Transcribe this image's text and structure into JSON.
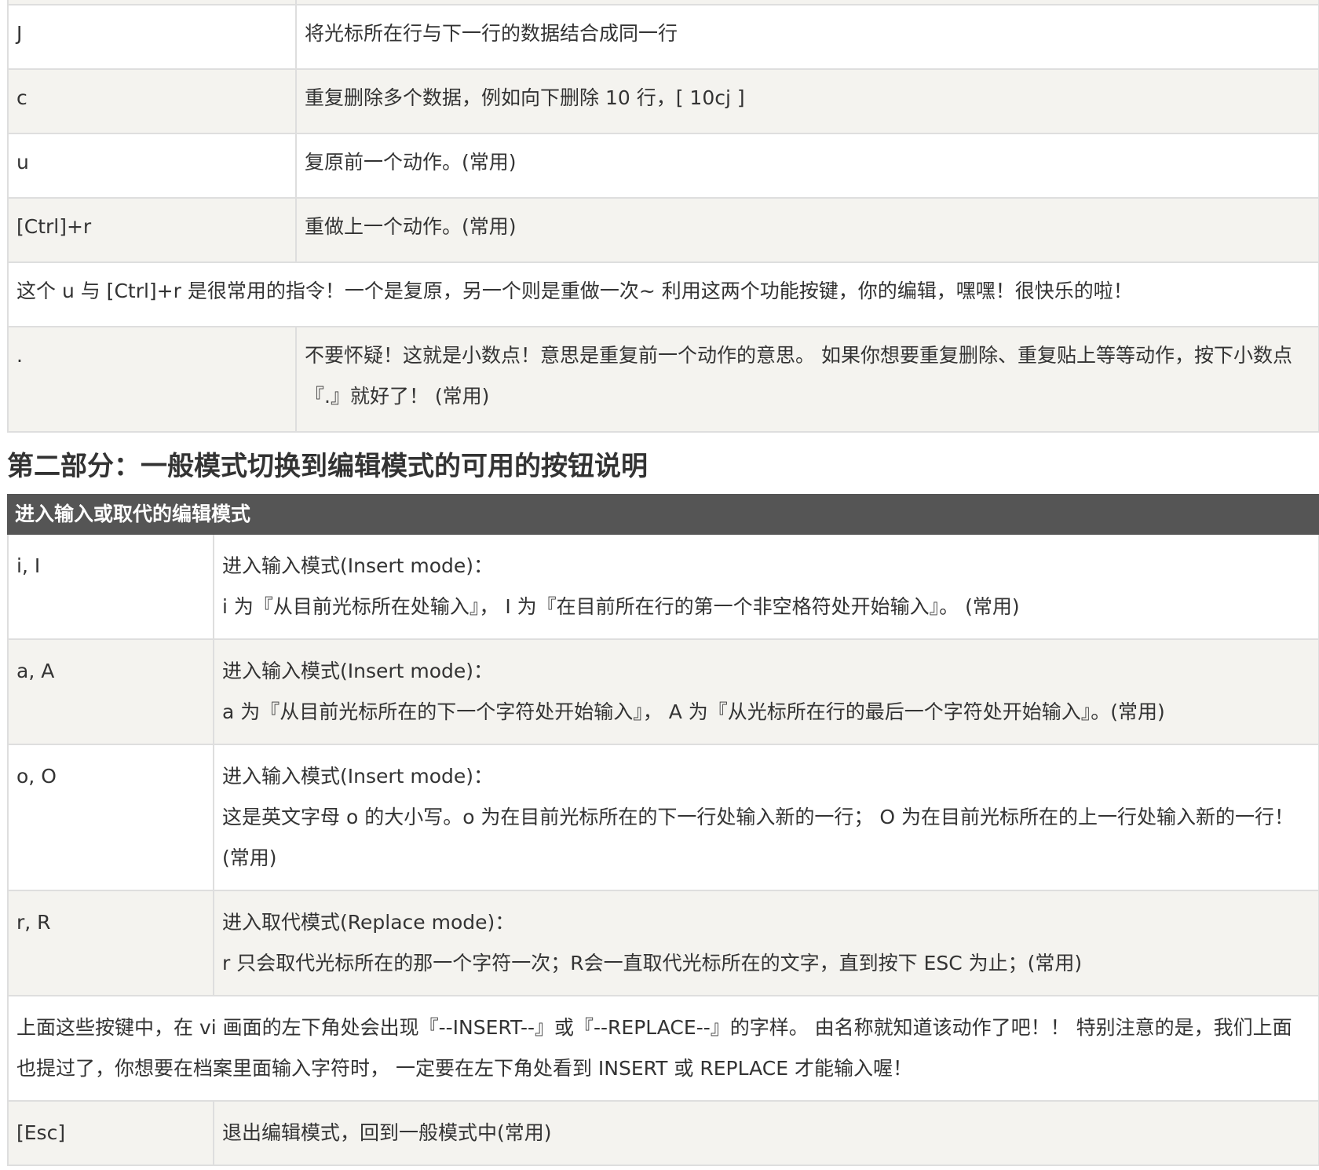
{
  "table1": {
    "rows": [
      {
        "key": "J",
        "desc": "将光标所在行与下一行的数据结合成同一行"
      },
      {
        "key": "c",
        "desc": "重复删除多个数据，例如向下删除 10 行，[ 10cj ]"
      },
      {
        "key": "u",
        "desc": "复原前一个动作。(常用)"
      },
      {
        "key": "[Ctrl]+r",
        "desc": "重做上一个动作。(常用)"
      }
    ],
    "note": "这个 u 与 [Ctrl]+r 是很常用的指令！一个是复原，另一个则是重做一次~ 利用这两个功能按键，你的编辑，嘿嘿！很快乐的啦！",
    "dot_row": {
      "key": ".",
      "desc": "不要怀疑！这就是小数点！意思是重复前一个动作的意思。 如果你想要重复删除、重复贴上等等动作，按下小数点『.』就好了！ (常用)"
    }
  },
  "section_title": "第二部分：一般模式切换到编辑模式的可用的按钮说明",
  "table2": {
    "header": "进入输入或取代的编辑模式",
    "rows": [
      {
        "key": "i, I",
        "line1": "进入输入模式(Insert mode)：",
        "line2": "i 为『从目前光标所在处输入』， I 为『在目前所在行的第一个非空格符处开始输入』。 (常用)"
      },
      {
        "key": "a, A",
        "line1": "进入输入模式(Insert mode)：",
        "line2": "a 为『从目前光标所在的下一个字符处开始输入』， A 为『从光标所在行的最后一个字符处开始输入』。(常用)"
      },
      {
        "key": "o, O",
        "line1": "进入输入模式(Insert mode)：",
        "line2": "这是英文字母 o 的大小写。o 为在目前光标所在的下一行处输入新的一行； O 为在目前光标所在的上一行处输入新的一行！(常用)"
      },
      {
        "key": "r, R",
        "line1": "进入取代模式(Replace mode)：",
        "line2": "r 只会取代光标所在的那一个字符一次；R会一直取代光标所在的文字，直到按下 ESC 为止；(常用)"
      }
    ],
    "note": "上面这些按键中，在 vi 画面的左下角处会出现『--INSERT--』或『--REPLACE--』的字样。 由名称就知道该动作了吧！！ 特别注意的是，我们上面也提过了，你想要在档案里面输入字符时， 一定要在左下角处看到 INSERT 或 REPLACE 才能输入喔！",
    "esc_row": {
      "key": "[Esc]",
      "desc": "退出编辑模式，回到一般模式中(常用)"
    }
  }
}
